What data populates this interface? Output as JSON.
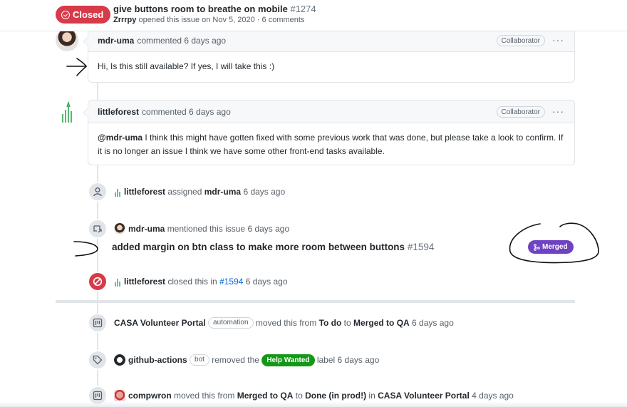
{
  "header": {
    "state_label": "Closed",
    "state_color": "#d73a49",
    "title": "give buttons room to breathe on mobile",
    "number": "#1274",
    "opener": "Zrrrpy",
    "meta_rest": "opened this issue on Nov 5, 2020 · 6 comments"
  },
  "comments": [
    {
      "author": "mdr-uma",
      "action": "commented 6 days ago",
      "role": "Collaborator",
      "body": "Hi, Is this still available? If yes, I will take this :)"
    },
    {
      "author": "littleforest",
      "action": "commented 6 days ago",
      "role": "Collaborator",
      "mention": "@mdr-uma",
      "body": "I think this might have gotten fixed with some previous work that was done, but please take a look to confirm. If it is no longer an issue I think we have some other front-end tasks available."
    }
  ],
  "events": {
    "assigned": {
      "actor": "littleforest",
      "verb": "assigned",
      "target": "mdr-uma",
      "time": "6 days ago",
      "icon": "person-icon"
    },
    "mentioned": {
      "actor": "mdr-uma",
      "verb": "mentioned this issue",
      "time": "6 days ago",
      "icon": "cross-reference-icon",
      "ref_title": "added margin on btn class to make more room between buttons",
      "ref_number": "#1594",
      "ref_state": "Merged",
      "ref_state_color": "#6f42c1"
    },
    "closed": {
      "actor": "littleforest",
      "verb": "closed this in",
      "ref": "#1594",
      "time": "6 days ago",
      "icon": "circle-slash-icon"
    },
    "moved1": {
      "actor": "CASA Volunteer Portal",
      "chip": "automation",
      "verb": "moved this from",
      "from": "To do",
      "to_word": "to",
      "to": "Merged to QA",
      "time": "6 days ago",
      "icon": "project-icon"
    },
    "label_removed": {
      "actor": "github-actions",
      "chip": "bot",
      "verb": "removed the",
      "label": "Help Wanted",
      "label_color": "#159818",
      "suffix": "label 6 days ago",
      "icon": "tag-icon"
    },
    "moved2": {
      "actor": "compwron",
      "verb": "moved this from",
      "from": "Merged to QA",
      "to_word": "to",
      "to": "Done (in prod!)",
      "in_word": "in",
      "project": "CASA Volunteer Portal",
      "time": "4 days ago",
      "icon": "project-icon"
    }
  },
  "colors": {
    "accent_link": "#0366d6",
    "border": "#e1e4e8",
    "muted": "#586069"
  }
}
